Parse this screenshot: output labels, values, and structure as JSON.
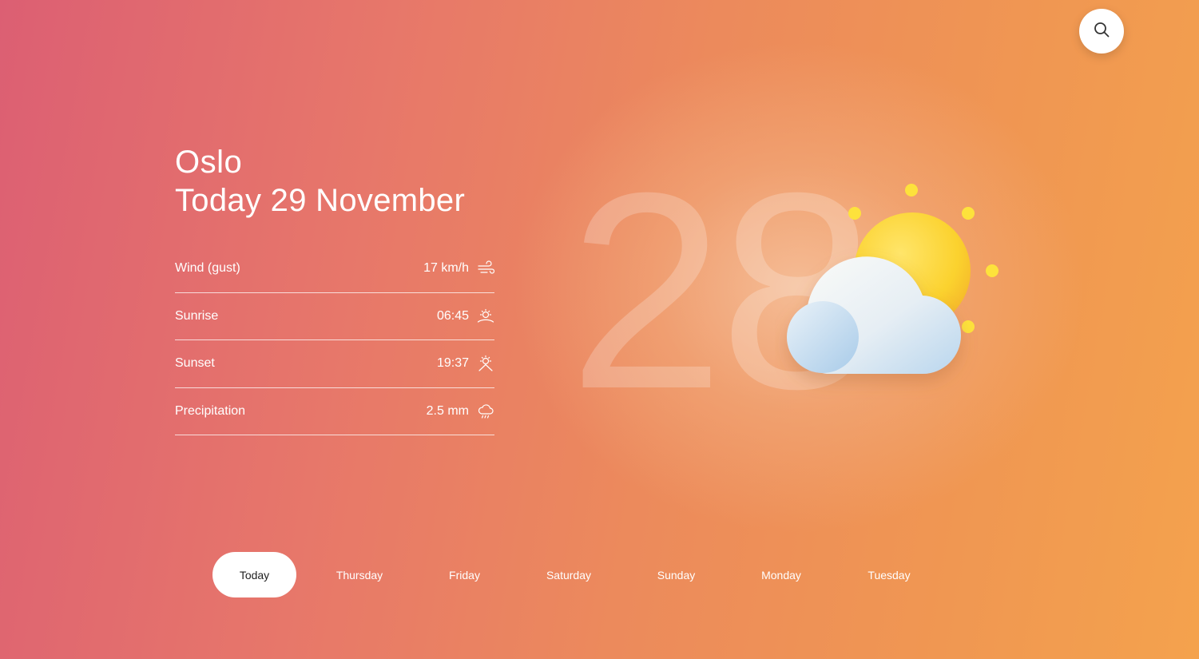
{
  "location": {
    "city": "Oslo",
    "date": "Today 29 November"
  },
  "details": [
    {
      "label": "Wind (gust)",
      "value": "17 km/h",
      "icon": "wind-icon"
    },
    {
      "label": "Sunrise",
      "value": "06:45",
      "icon": "sunrise-icon"
    },
    {
      "label": "Sunset",
      "value": "19:37",
      "icon": "sunset-icon"
    },
    {
      "label": "Precipitation",
      "value": "2.5 mm",
      "icon": "rain-cloud-icon"
    }
  ],
  "current": {
    "temperature": "28",
    "condition_icon": "partly-cloudy-icon"
  },
  "days": [
    "Today",
    "Thursday",
    "Friday",
    "Saturday",
    "Sunday",
    "Monday",
    "Tuesday"
  ],
  "active_day": "Today",
  "search": {
    "icon": "search-icon"
  },
  "colors": {
    "gradient_start": "#dc5f73",
    "gradient_end": "#f4a24d",
    "sun": "#fcd93a",
    "cloud": "#eef3f8"
  }
}
